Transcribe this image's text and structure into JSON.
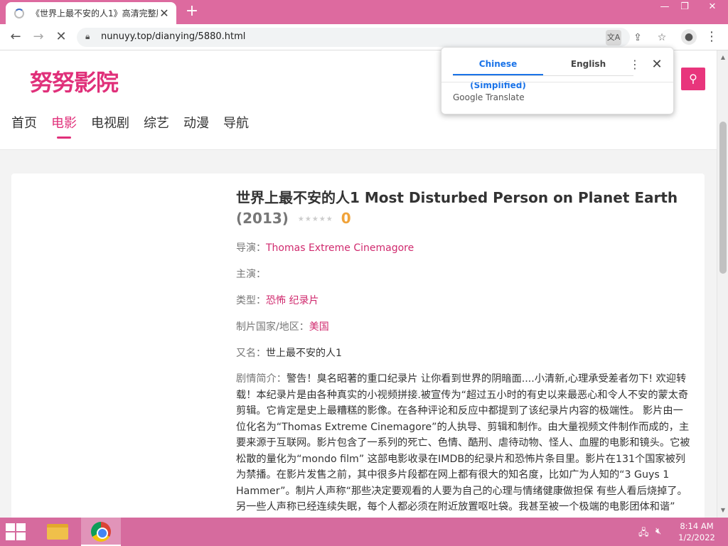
{
  "browser": {
    "tab_title": "《世界上最不安的人1》高清完整版",
    "tab_close": "✕",
    "new_tab": "+",
    "url": "nunuyy.top/dianying/5880.html",
    "window_controls": {
      "minimize": "—",
      "maximize": "❐",
      "close": "✕"
    }
  },
  "translate_popup": {
    "source_lang": "Chinese (Simplified)",
    "target_lang": "English",
    "provider": "Google Translate"
  },
  "site": {
    "logo": "努努影院",
    "nav": [
      "首页",
      "电影",
      "电视剧",
      "综艺",
      "动漫",
      "导航"
    ],
    "active_nav_index": 1
  },
  "movie": {
    "title": "世界上最不安的人1 Most Disturbed Person on Planet Earth",
    "year": "(2013)",
    "stars": "★★★★★",
    "rating": "0",
    "director_label": "导演：",
    "director": "Thomas Extreme Cinemagore",
    "cast_label": "主演：",
    "genre_label": "类型：",
    "genres": "恐怖 纪录片",
    "country_label": "制片国家/地区：",
    "country": "美国",
    "alias_label": "又名：",
    "alias": "世上最不安的人1",
    "synopsis_label": "剧情简介：",
    "synopsis": "警告！臭名昭著的重口纪录片 让你看到世界的阴暗面....小清新,心理承受差者勿下! 欢迎转载！本纪录片是由各种真实的小视频拼接.被宣传为“超过五小时的有史以来最恶心和令人不安的蒙太奇剪辑。它肯定是史上最糟糕的影像。在各种评论和反应中都提到了该纪录片内容的极端性。 影片由一位化名为“Thomas Extreme Cinemagore”的人执导、剪辑和制作。由大量视频文件制作而成的，主要来源于互联网。影片包含了一系列的死亡、色情、酷刑、虐待动物、怪人、血腥的电影和镜头。它被松散的量化为“mondo film” 这部电影收录在IMDB的纪录片和恐怖片条目里。影片在131个国家被列为禁播。在影片发售之前，其中很多片段都在网上都有很大的知名度，比如广为人知的“3 Guys 1 Hammer”。制片人声称“那些决定要观看的人要为自己的心理与情绪健康做担保 有些人看后烧掉了。另一些人声称已经连续失眠，每个人都必须在附近放置呕吐袋。我甚至被一个极端的电影团体和谐”"
  },
  "taskbar": {
    "time": "8:14 AM",
    "date": "1/2/2022"
  },
  "colors": {
    "accent": "#e0307a",
    "titlebar": "#dd6a9f",
    "taskbar": "#d66b9e",
    "rating": "#f0a33a"
  }
}
